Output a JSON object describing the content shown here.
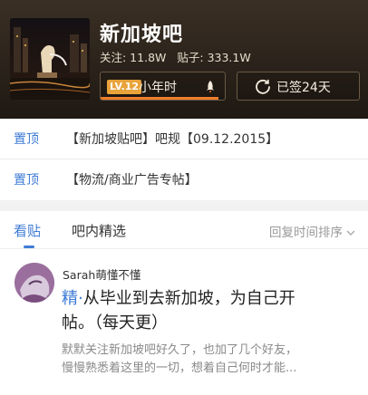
{
  "forum": {
    "name": "新加坡吧",
    "followers_label": "关注: 11.8W",
    "posts_label": "贴子: 333.1W",
    "level_badge": "LV.12",
    "level_name": "小年时",
    "level_progress": 0.95,
    "sign_label": "已签24天"
  },
  "pinned": [
    {
      "tag": "置顶",
      "text": "【新加坡贴吧】吧规【09.12.2015】"
    },
    {
      "tag": "置顶",
      "text": "【物流/商业广告专帖】"
    }
  ],
  "tabs": {
    "active": "看贴",
    "second": "吧内精选",
    "sort": "回复时间排序"
  },
  "post": {
    "author": "Sarah萌懂不懂",
    "badge": "精",
    "dot": "·",
    "title_1": "从毕业到去新加坡，为自己开",
    "title_2": "帖。（每天更）",
    "excerpt_1": "默默关注新加坡吧好久了，也加了几个好友，",
    "excerpt_2": "慢慢熟悉着这里的一切，想着自己何时才能..."
  },
  "colors": {
    "accent": "#3e7bd6",
    "level_orange": "#ef7d2a",
    "header_bg": "#2b231b"
  },
  "icons": [
    "rocket-icon",
    "refresh-icon",
    "chevron-down-icon",
    "forum-cover-image",
    "avatar"
  ]
}
